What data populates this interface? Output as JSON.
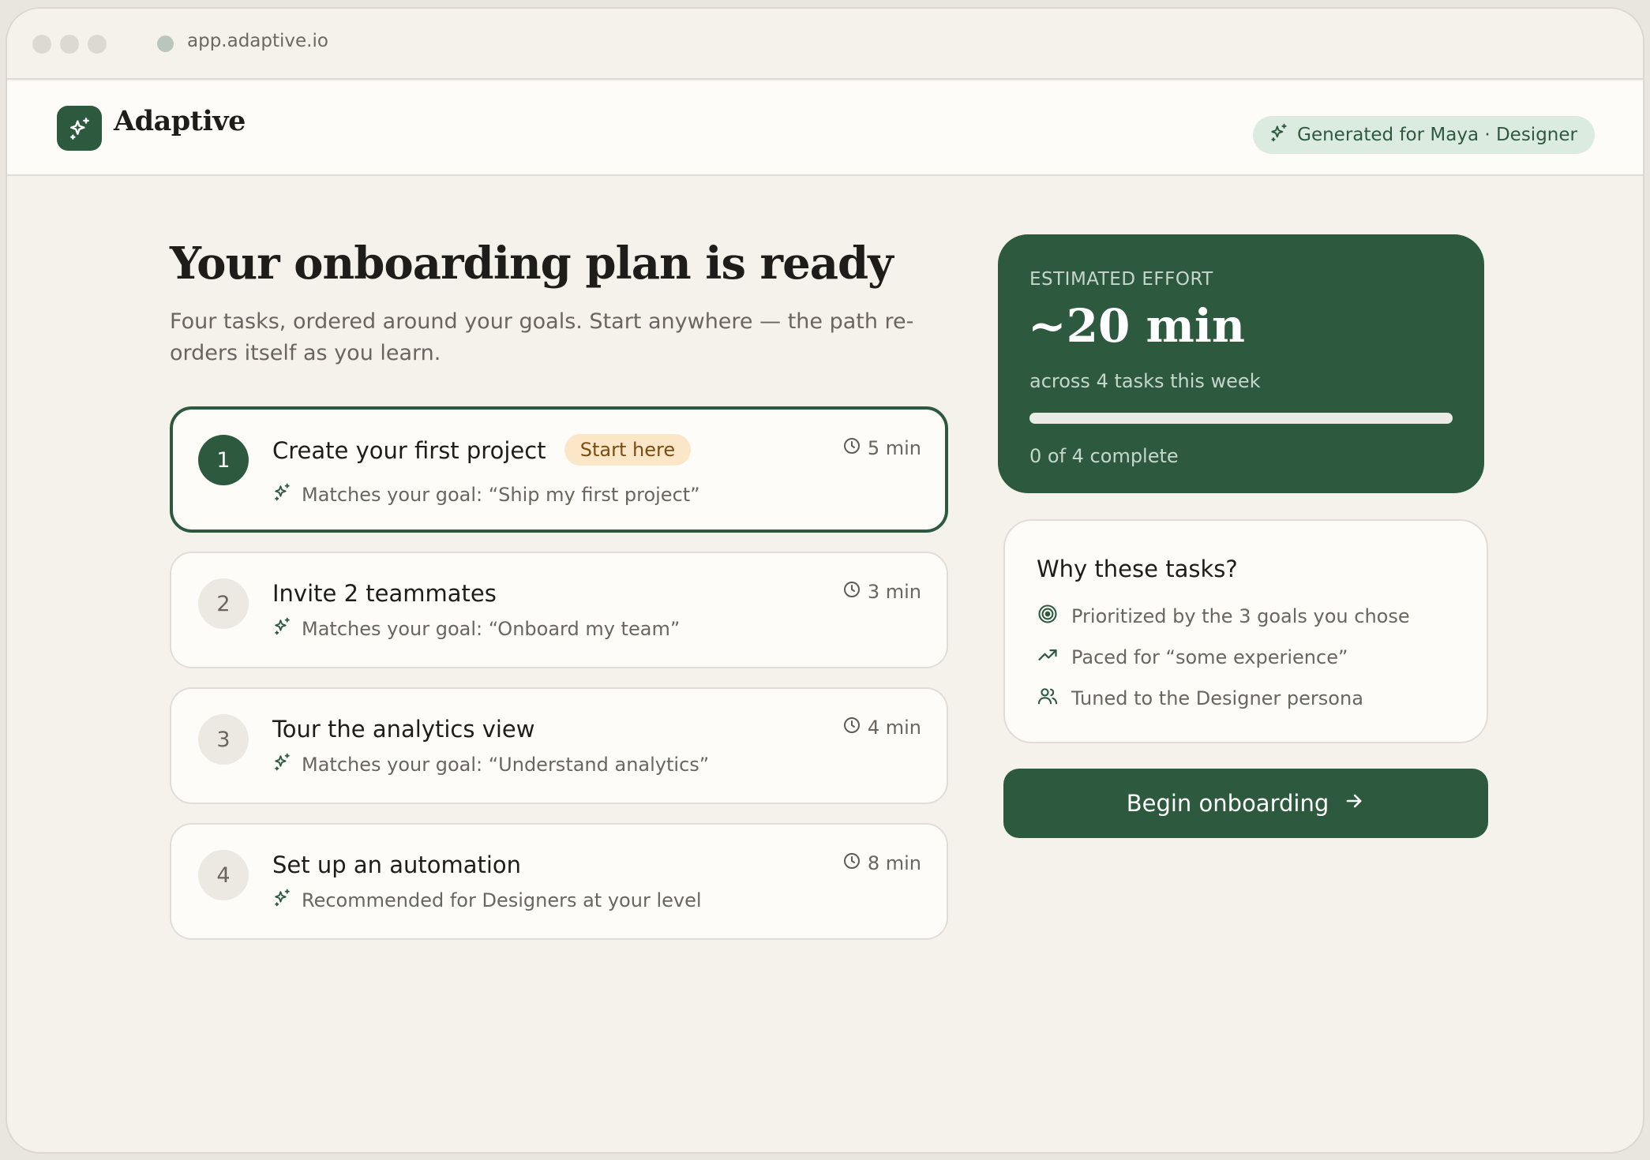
{
  "browser": {
    "url": "app.adaptive.io"
  },
  "app": {
    "brand": "Adaptive",
    "generated_for": "Generated for Maya · Designer"
  },
  "main": {
    "title": "Your onboarding plan is ready",
    "subtitle": "Four tasks, ordered around your goals. Start anywhere — the path re-orders itself as you learn."
  },
  "tasks": [
    {
      "number": "1",
      "title": "Create your first project",
      "badge": "Start here",
      "reason": "Matches your goal: “Ship my first project”",
      "duration": "5 min"
    },
    {
      "number": "2",
      "title": "Invite 2 teammates",
      "reason": "Matches your goal: “Onboard my team”",
      "duration": "3 min"
    },
    {
      "number": "3",
      "title": "Tour the analytics view",
      "reason": "Matches your goal: “Understand analytics”",
      "duration": "4 min"
    },
    {
      "number": "4",
      "title": "Set up an automation",
      "reason": "Recommended for Designers at your level",
      "duration": "8 min"
    }
  ],
  "effort": {
    "label": "ESTIMATED EFFORT",
    "value": "~20 min",
    "sub": "across 4 tasks this week",
    "progress_fraction": 0.0,
    "progress_text": "0 of 4 complete"
  },
  "why": {
    "title": "Why these tasks?",
    "items": [
      {
        "icon": "target-icon",
        "text": "Prioritized by the 3 goals you chose"
      },
      {
        "icon": "trending-up-icon",
        "text": "Paced for “some experience”"
      },
      {
        "icon": "users-icon",
        "text": "Tuned to the Designer persona"
      }
    ]
  },
  "cta": {
    "label": "Begin onboarding"
  },
  "colors": {
    "brand_green": "#2d5a3f",
    "badge_bg": "#fbe6c8",
    "pill_bg": "#dcebe0",
    "page_bg": "#f5f2ec"
  }
}
